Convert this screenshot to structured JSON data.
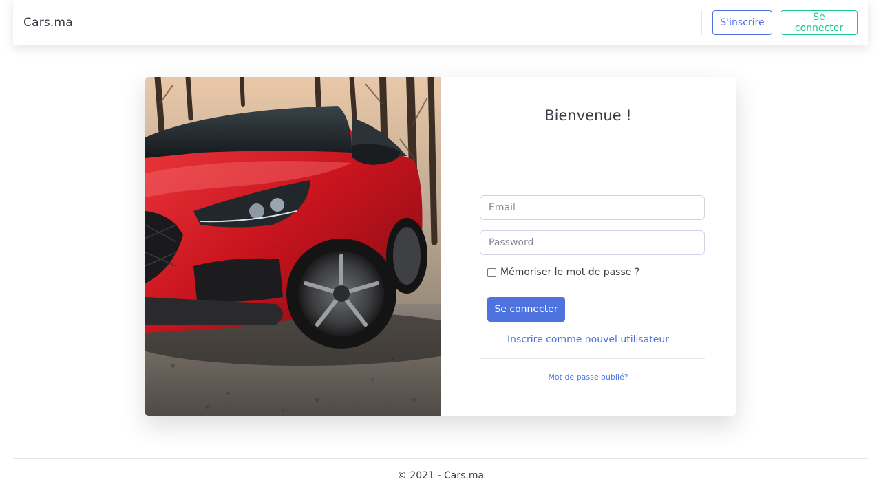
{
  "navbar": {
    "brand": "Cars.ma",
    "signup_label": "S'inscrire",
    "login_label": "Se connecter"
  },
  "login_card": {
    "image": {
      "alt": "red car"
    },
    "title": "Bienvenue !",
    "email": {
      "placeholder": "Email",
      "value": ""
    },
    "password": {
      "placeholder": "Password",
      "value": ""
    },
    "remember": {
      "label": "Mémoriser le mot de passe ?",
      "checked": false
    },
    "submit_label": "Se connecter",
    "register_link": "Inscrire comme nouvel utilisateur",
    "forgot_link": "Mot de passe oublié?"
  },
  "footer": {
    "text": "© 2021 - Cars.ma"
  },
  "colors": {
    "primary": "#4e73df",
    "success": "#1cc88a",
    "car_red": "#d0202a"
  }
}
